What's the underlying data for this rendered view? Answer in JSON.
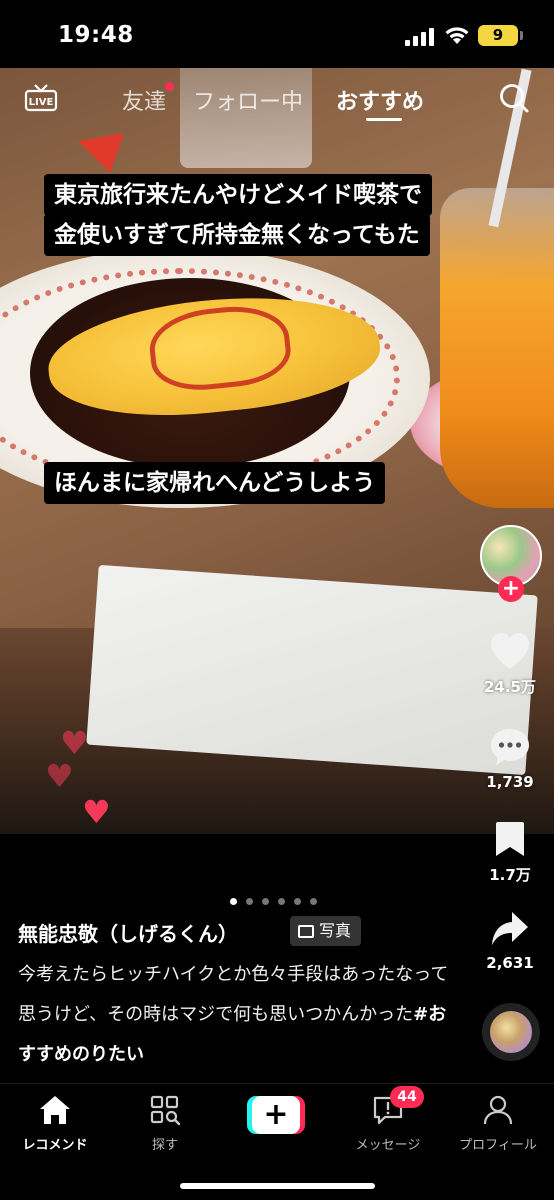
{
  "status_bar": {
    "time": "19:48",
    "battery": "9"
  },
  "top_nav": {
    "live_icon": "live-icon",
    "tabs": [
      {
        "label": "友達",
        "has_dot": true
      },
      {
        "label": "フォロー中"
      },
      {
        "label": "おすすめ",
        "active": true
      }
    ],
    "search_icon": "search-icon"
  },
  "captions": {
    "line1": "東京旅行来たんやけどメイド喫茶で",
    "line2": "金使いすぎて所持金無くなってもた",
    "line3": "ほんまに家帰れへんどうしよう"
  },
  "actions": {
    "likes": "24.5万",
    "comments": "1,739",
    "bookmarks": "1.7万",
    "shares": "2,631"
  },
  "post": {
    "author": "無能忠敬（しげるくん）",
    "badge": "写真",
    "description": "今考えたらヒッチハイクとか色々手段はあったなって思うけど、その時はマジで何も思いつかんかった",
    "hashtag": "#おすすめのりたい",
    "carousel_total": 6,
    "carousel_index": 1
  },
  "tab_bar": {
    "home": "レコメンド",
    "discover": "探す",
    "inbox": "メッセージ",
    "inbox_badge": "44",
    "profile": "プロフィール"
  },
  "colors": {
    "accent": "#fe2c55",
    "accent_cyan": "#25f4ee",
    "battery": "#f4d640"
  }
}
